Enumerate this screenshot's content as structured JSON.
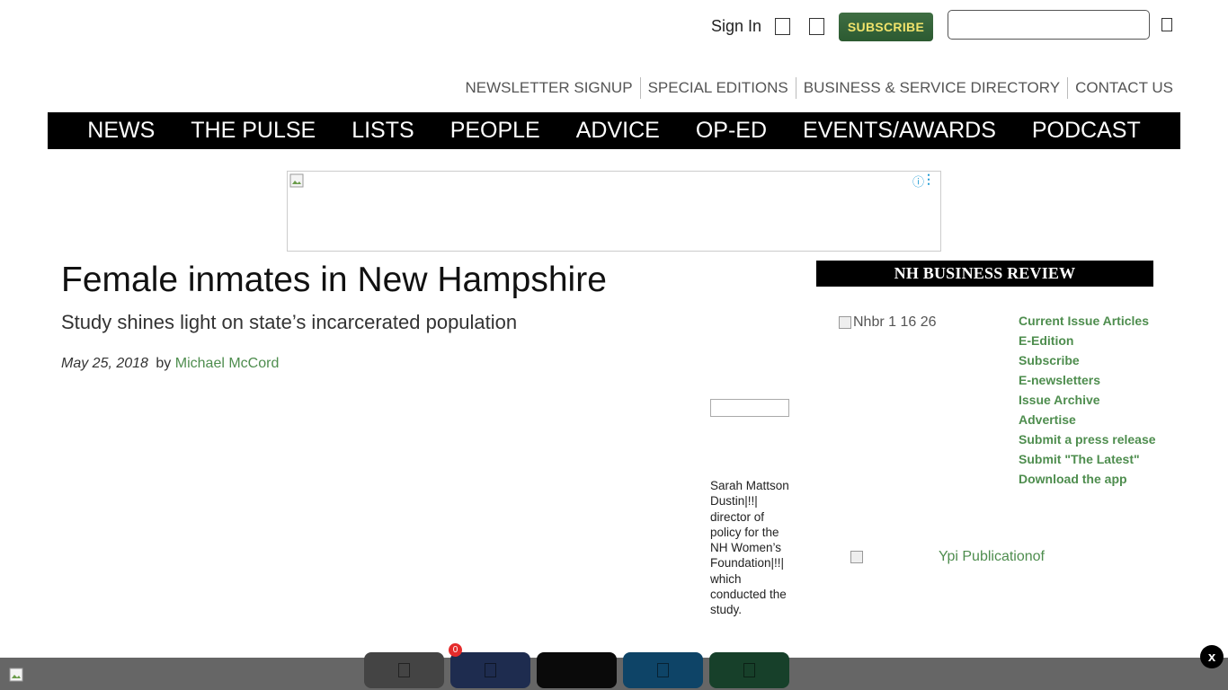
{
  "header": {
    "sign_in": "Sign In",
    "subscribe": "SUBSCRIBE",
    "search_placeholder": ""
  },
  "secondary_nav": [
    "NEWSLETTER SIGNUP",
    "SPECIAL EDITIONS",
    "BUSINESS & SERVICE DIRECTORY",
    "CONTACT US"
  ],
  "main_nav": [
    "NEWS",
    "THE PULSE",
    "LISTS",
    "PEOPLE",
    "ADVICE",
    "OP-ED",
    "EVENTS/AWARDS",
    "PODCAST"
  ],
  "ad": {
    "info_glyph": "ⓘ",
    "menu_glyph": "⋮"
  },
  "article": {
    "headline": "Female inmates in New Hampshire",
    "subhead": "Study shines light on state’s incarcerated population",
    "date": "May 25, 2018",
    "by": "by",
    "author": "Michael McCord",
    "caption": "Sarah Mattson Dustin|!!| director of policy for the NH Women’s Foundation|!!| which conducted the study."
  },
  "sidebar": {
    "header": "NH BUSINESS REVIEW",
    "cover_alt": "Nhbr 1 16 26",
    "links": [
      "Current Issue Articles",
      "E-Edition",
      "Subscribe",
      "E-newsletters",
      "Issue Archive",
      "Advertise",
      "Submit a press release",
      "Submit \"The Latest\"",
      "Download the app"
    ],
    "ypi_alt": "Ypi Publicationof"
  },
  "share_bar": {
    "badge_count": "0",
    "close_label": "x",
    "buttons": [
      {
        "name": "email",
        "color": "#444444"
      },
      {
        "name": "facebook",
        "color": "#1e2c4f"
      },
      {
        "name": "x-twitter",
        "color": "#0a0a0a"
      },
      {
        "name": "linkedin",
        "color": "#0e4467"
      },
      {
        "name": "sms",
        "color": "#17402a"
      }
    ]
  },
  "colors": {
    "accent_green": "#4e8d4e",
    "subscribe_bg": "#2c5a31",
    "subscribe_text": "#f1e36b",
    "nav_bg": "#000000"
  }
}
